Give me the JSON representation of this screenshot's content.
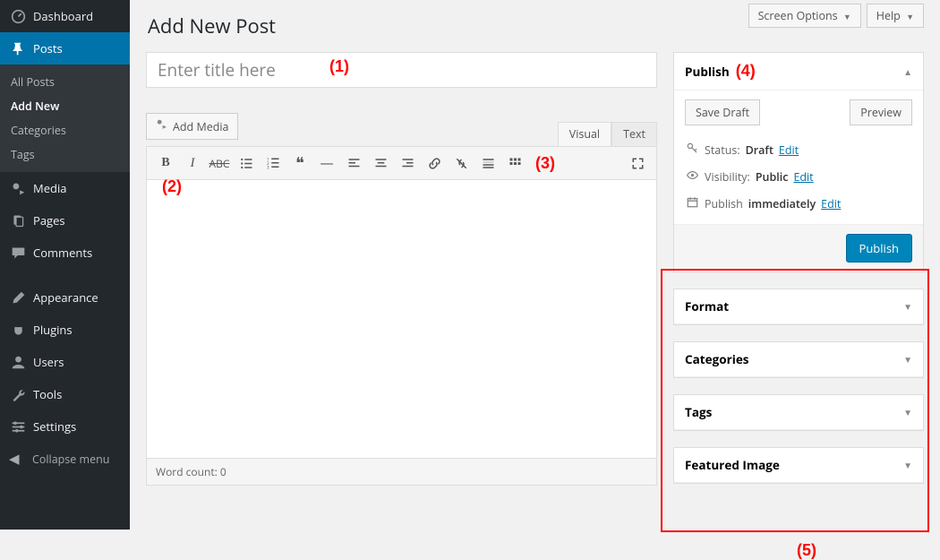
{
  "sidebar": {
    "dashboard": "Dashboard",
    "posts": "Posts",
    "posts_sub": {
      "all": "All Posts",
      "add": "Add New",
      "cat": "Categories",
      "tags": "Tags"
    },
    "media": "Media",
    "pages": "Pages",
    "comments": "Comments",
    "appearance": "Appearance",
    "plugins": "Plugins",
    "users": "Users",
    "tools": "Tools",
    "settings": "Settings",
    "collapse": "Collapse menu"
  },
  "top": {
    "screen_options": "Screen Options",
    "help": "Help"
  },
  "page_title": "Add New Post",
  "title_placeholder": "Enter title here",
  "add_media": "Add Media",
  "tabs": {
    "visual": "Visual",
    "text": "Text"
  },
  "word_count": "Word count: 0",
  "publish": {
    "title": "Publish",
    "save_draft": "Save Draft",
    "preview": "Preview",
    "status_label": "Status:",
    "status_value": "Draft",
    "visibility_label": "Visibility:",
    "visibility_value": "Public",
    "publish_label": "Publish",
    "publish_value": "immediately",
    "edit": "Edit",
    "button": "Publish"
  },
  "boxes": {
    "format": "Format",
    "categories": "Categories",
    "tags": "Tags",
    "featured": "Featured Image"
  },
  "ann": {
    "a1": "(1)",
    "a2": "(2)",
    "a3": "(3)",
    "a4": "(4)",
    "a5": "(5)"
  }
}
